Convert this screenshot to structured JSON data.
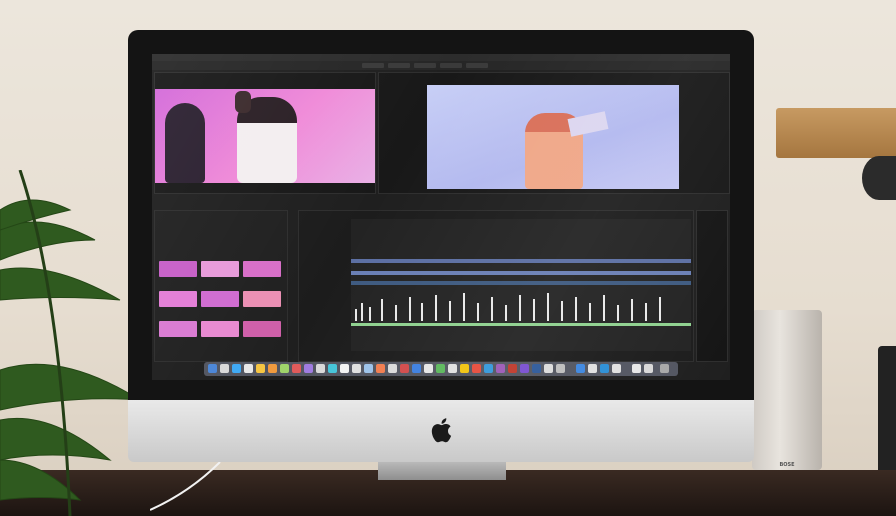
{
  "scene": {
    "description_free": true,
    "colors": {
      "wall": "#ece6dc",
      "desk": "#2a1e19",
      "shelf": "#b98748",
      "bezel": "#141414",
      "chin": "#dcdcdc",
      "source_frame": "#e27be0",
      "program_frame": "#c0c6f4",
      "timeline_track": "#2f3a45",
      "plant": "#2f5a1f"
    },
    "icons": {
      "apple_logo": "apple-logo-icon",
      "speaker_logo": "bose-logo"
    }
  },
  "screen": {
    "speaker_label": "BOSE"
  }
}
